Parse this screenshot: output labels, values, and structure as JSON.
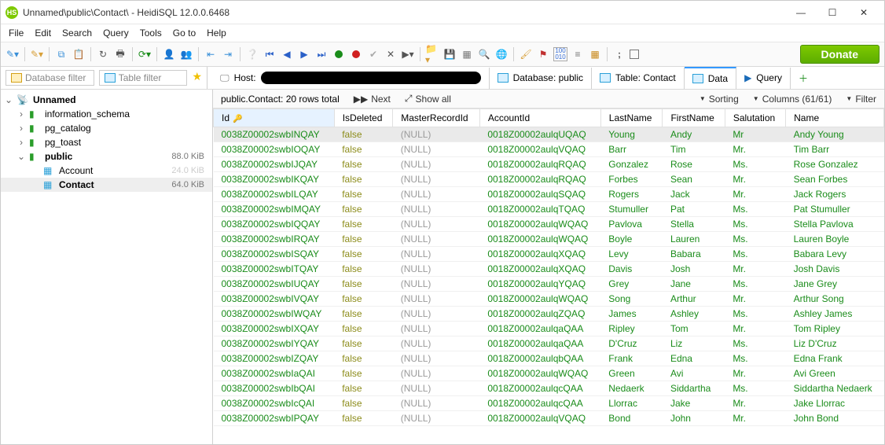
{
  "window": {
    "title": "Unnamed\\public\\Contact\\ - HeidiSQL 12.0.0.6468"
  },
  "menu": [
    "File",
    "Edit",
    "Search",
    "Query",
    "Tools",
    "Go to",
    "Help"
  ],
  "donate": "Donate",
  "filters": {
    "db": "Database filter",
    "table": "Table filter"
  },
  "tabs": {
    "host": "Host:",
    "database": "Database: public",
    "table": "Table: Contact",
    "data": "Data",
    "query": "Query"
  },
  "tree": {
    "root": "Unnamed",
    "nodes": [
      {
        "label": "information_schema",
        "size": ""
      },
      {
        "label": "pg_catalog",
        "size": ""
      },
      {
        "label": "pg_toast",
        "size": ""
      },
      {
        "label": "public",
        "size": "88.0 KiB",
        "expanded": true,
        "children": [
          {
            "label": "Account",
            "size": "24.0 KiB"
          },
          {
            "label": "Contact",
            "size": "64.0 KiB",
            "selected": true
          }
        ]
      }
    ]
  },
  "subbar": {
    "summary": "public.Contact: 20 rows total",
    "next": "Next",
    "showall": "Show all",
    "sorting": "Sorting",
    "columns": "Columns (61/61)",
    "filter": "Filter"
  },
  "columns": [
    "Id",
    "IsDeleted",
    "MasterRecordId",
    "AccountId",
    "LastName",
    "FirstName",
    "Salutation",
    "Name"
  ],
  "rows": [
    {
      "Id": "0038Z00002swbINQAY",
      "IsDeleted": "false",
      "MasterRecordId": "(NULL)",
      "AccountId": "0018Z00002aulqUQAQ",
      "LastName": "Young",
      "FirstName": "Andy",
      "Salutation": "Mr",
      "Name": "Andy Young",
      "sel": true
    },
    {
      "Id": "0038Z00002swbIOQAY",
      "IsDeleted": "false",
      "MasterRecordId": "(NULL)",
      "AccountId": "0018Z00002aulqVQAQ",
      "LastName": "Barr",
      "FirstName": "Tim",
      "Salutation": "Mr.",
      "Name": "Tim Barr"
    },
    {
      "Id": "0038Z00002swbIJQAY",
      "IsDeleted": "false",
      "MasterRecordId": "(NULL)",
      "AccountId": "0018Z00002aulqRQAQ",
      "LastName": "Gonzalez",
      "FirstName": "Rose",
      "Salutation": "Ms.",
      "Name": "Rose Gonzalez"
    },
    {
      "Id": "0038Z00002swbIKQAY",
      "IsDeleted": "false",
      "MasterRecordId": "(NULL)",
      "AccountId": "0018Z00002aulqRQAQ",
      "LastName": "Forbes",
      "FirstName": "Sean",
      "Salutation": "Mr.",
      "Name": "Sean Forbes"
    },
    {
      "Id": "0038Z00002swbILQAY",
      "IsDeleted": "false",
      "MasterRecordId": "(NULL)",
      "AccountId": "0018Z00002aulqSQAQ",
      "LastName": "Rogers",
      "FirstName": "Jack",
      "Salutation": "Mr.",
      "Name": "Jack Rogers"
    },
    {
      "Id": "0038Z00002swbIMQAY",
      "IsDeleted": "false",
      "MasterRecordId": "(NULL)",
      "AccountId": "0018Z00002aulqTQAQ",
      "LastName": "Stumuller",
      "FirstName": "Pat",
      "Salutation": "Ms.",
      "Name": "Pat Stumuller"
    },
    {
      "Id": "0038Z00002swbIQQAY",
      "IsDeleted": "false",
      "MasterRecordId": "(NULL)",
      "AccountId": "0018Z00002aulqWQAQ",
      "LastName": "Pavlova",
      "FirstName": "Stella",
      "Salutation": "Ms.",
      "Name": "Stella Pavlova"
    },
    {
      "Id": "0038Z00002swbIRQAY",
      "IsDeleted": "false",
      "MasterRecordId": "(NULL)",
      "AccountId": "0018Z00002aulqWQAQ",
      "LastName": "Boyle",
      "FirstName": "Lauren",
      "Salutation": "Ms.",
      "Name": "Lauren Boyle"
    },
    {
      "Id": "0038Z00002swbISQAY",
      "IsDeleted": "false",
      "MasterRecordId": "(NULL)",
      "AccountId": "0018Z00002aulqXQAQ",
      "LastName": "Levy",
      "FirstName": "Babara",
      "Salutation": "Ms.",
      "Name": "Babara Levy"
    },
    {
      "Id": "0038Z00002swbITQAY",
      "IsDeleted": "false",
      "MasterRecordId": "(NULL)",
      "AccountId": "0018Z00002aulqXQAQ",
      "LastName": "Davis",
      "FirstName": "Josh",
      "Salutation": "Mr.",
      "Name": "Josh Davis"
    },
    {
      "Id": "0038Z00002swbIUQAY",
      "IsDeleted": "false",
      "MasterRecordId": "(NULL)",
      "AccountId": "0018Z00002aulqYQAQ",
      "LastName": "Grey",
      "FirstName": "Jane",
      "Salutation": "Ms.",
      "Name": "Jane Grey"
    },
    {
      "Id": "0038Z00002swbIVQAY",
      "IsDeleted": "false",
      "MasterRecordId": "(NULL)",
      "AccountId": "0018Z00002aulqWQAQ",
      "LastName": "Song",
      "FirstName": "Arthur",
      "Salutation": "Mr.",
      "Name": "Arthur Song"
    },
    {
      "Id": "0038Z00002swbIWQAY",
      "IsDeleted": "false",
      "MasterRecordId": "(NULL)",
      "AccountId": "0018Z00002aulqZQAQ",
      "LastName": "James",
      "FirstName": "Ashley",
      "Salutation": "Ms.",
      "Name": "Ashley James"
    },
    {
      "Id": "0038Z00002swbIXQAY",
      "IsDeleted": "false",
      "MasterRecordId": "(NULL)",
      "AccountId": "0018Z00002aulqaQAA",
      "LastName": "Ripley",
      "FirstName": "Tom",
      "Salutation": "Mr.",
      "Name": "Tom Ripley"
    },
    {
      "Id": "0038Z00002swbIYQAY",
      "IsDeleted": "false",
      "MasterRecordId": "(NULL)",
      "AccountId": "0018Z00002aulqaQAA",
      "LastName": "D'Cruz",
      "FirstName": "Liz",
      "Salutation": "Ms.",
      "Name": "Liz D'Cruz"
    },
    {
      "Id": "0038Z00002swbIZQAY",
      "IsDeleted": "false",
      "MasterRecordId": "(NULL)",
      "AccountId": "0018Z00002aulqbQAA",
      "LastName": "Frank",
      "FirstName": "Edna",
      "Salutation": "Ms.",
      "Name": "Edna Frank"
    },
    {
      "Id": "0038Z00002swbIaQAI",
      "IsDeleted": "false",
      "MasterRecordId": "(NULL)",
      "AccountId": "0018Z00002aulqWQAQ",
      "LastName": "Green",
      "FirstName": "Avi",
      "Salutation": "Mr.",
      "Name": "Avi Green"
    },
    {
      "Id": "0038Z00002swbIbQAI",
      "IsDeleted": "false",
      "MasterRecordId": "(NULL)",
      "AccountId": "0018Z00002aulqcQAA",
      "LastName": "Nedaerk",
      "FirstName": "Siddartha",
      "Salutation": "Ms.",
      "Name": "Siddartha Nedaerk"
    },
    {
      "Id": "0038Z00002swbIcQAI",
      "IsDeleted": "false",
      "MasterRecordId": "(NULL)",
      "AccountId": "0018Z00002aulqcQAA",
      "LastName": "Llorrac",
      "FirstName": "Jake",
      "Salutation": "Mr.",
      "Name": "Jake Llorrac"
    },
    {
      "Id": "0038Z00002swbIPQAY",
      "IsDeleted": "false",
      "MasterRecordId": "(NULL)",
      "AccountId": "0018Z00002aulqVQAQ",
      "LastName": "Bond",
      "FirstName": "John",
      "Salutation": "Mr.",
      "Name": "John Bond"
    }
  ]
}
